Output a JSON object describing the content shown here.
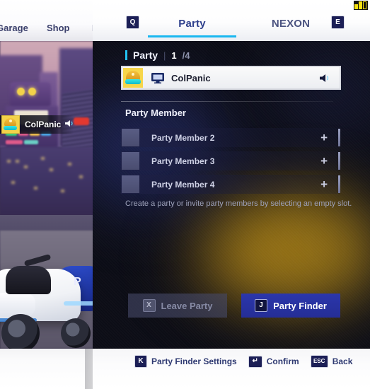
{
  "game_nav": {
    "items": [
      {
        "label": "Garage"
      },
      {
        "label": "Shop"
      },
      {
        "label": "M"
      }
    ]
  },
  "player_badge": {
    "name": "ColPanic",
    "speaker_icon": "speaker-icon",
    "avatar_icon": "helmet-avatar-icon"
  },
  "top_right_indicator": {
    "icon": "signal-indicator-icon"
  },
  "panel": {
    "tabs": [
      {
        "label": "Party",
        "key": "Q",
        "active": true
      },
      {
        "label": "NEXON",
        "key": "E",
        "active": false
      }
    ],
    "section": {
      "title": "Party",
      "separator": "|",
      "count_current": "1",
      "count_total": "/4"
    },
    "leader": {
      "name": "ColPanic",
      "platform_icon": "monitor-icon",
      "avatar_icon": "helmet-avatar-icon",
      "speaker_icon": "speaker-icon"
    },
    "party_member_heading": "Party Member",
    "slots": [
      {
        "label": "Party Member 2",
        "action_icon": "plus-icon"
      },
      {
        "label": "Party Member 3",
        "action_icon": "plus-icon"
      },
      {
        "label": "Party Member 4",
        "action_icon": "plus-icon"
      }
    ],
    "hint": "Create a party or invite party members by selecting an empty slot.",
    "buttons": [
      {
        "label": "Leave Party",
        "key": "X",
        "state": "disabled"
      },
      {
        "label": "Party Finder",
        "key": "J",
        "state": "primary"
      }
    ]
  },
  "hotkey_bar": {
    "items": [
      {
        "key": "K",
        "label": "Party Finder Settings"
      },
      {
        "key": "↵",
        "label": "Confirm"
      },
      {
        "key": "ESC",
        "label": "Back"
      }
    ]
  },
  "colors": {
    "accent_cyan": "#19b7f0",
    "primary_blue": "#2b36ab",
    "tab_active_text": "#2e3f8c",
    "panel_bg": "#0c0d16",
    "leader_row_bg": "#fafafa"
  }
}
